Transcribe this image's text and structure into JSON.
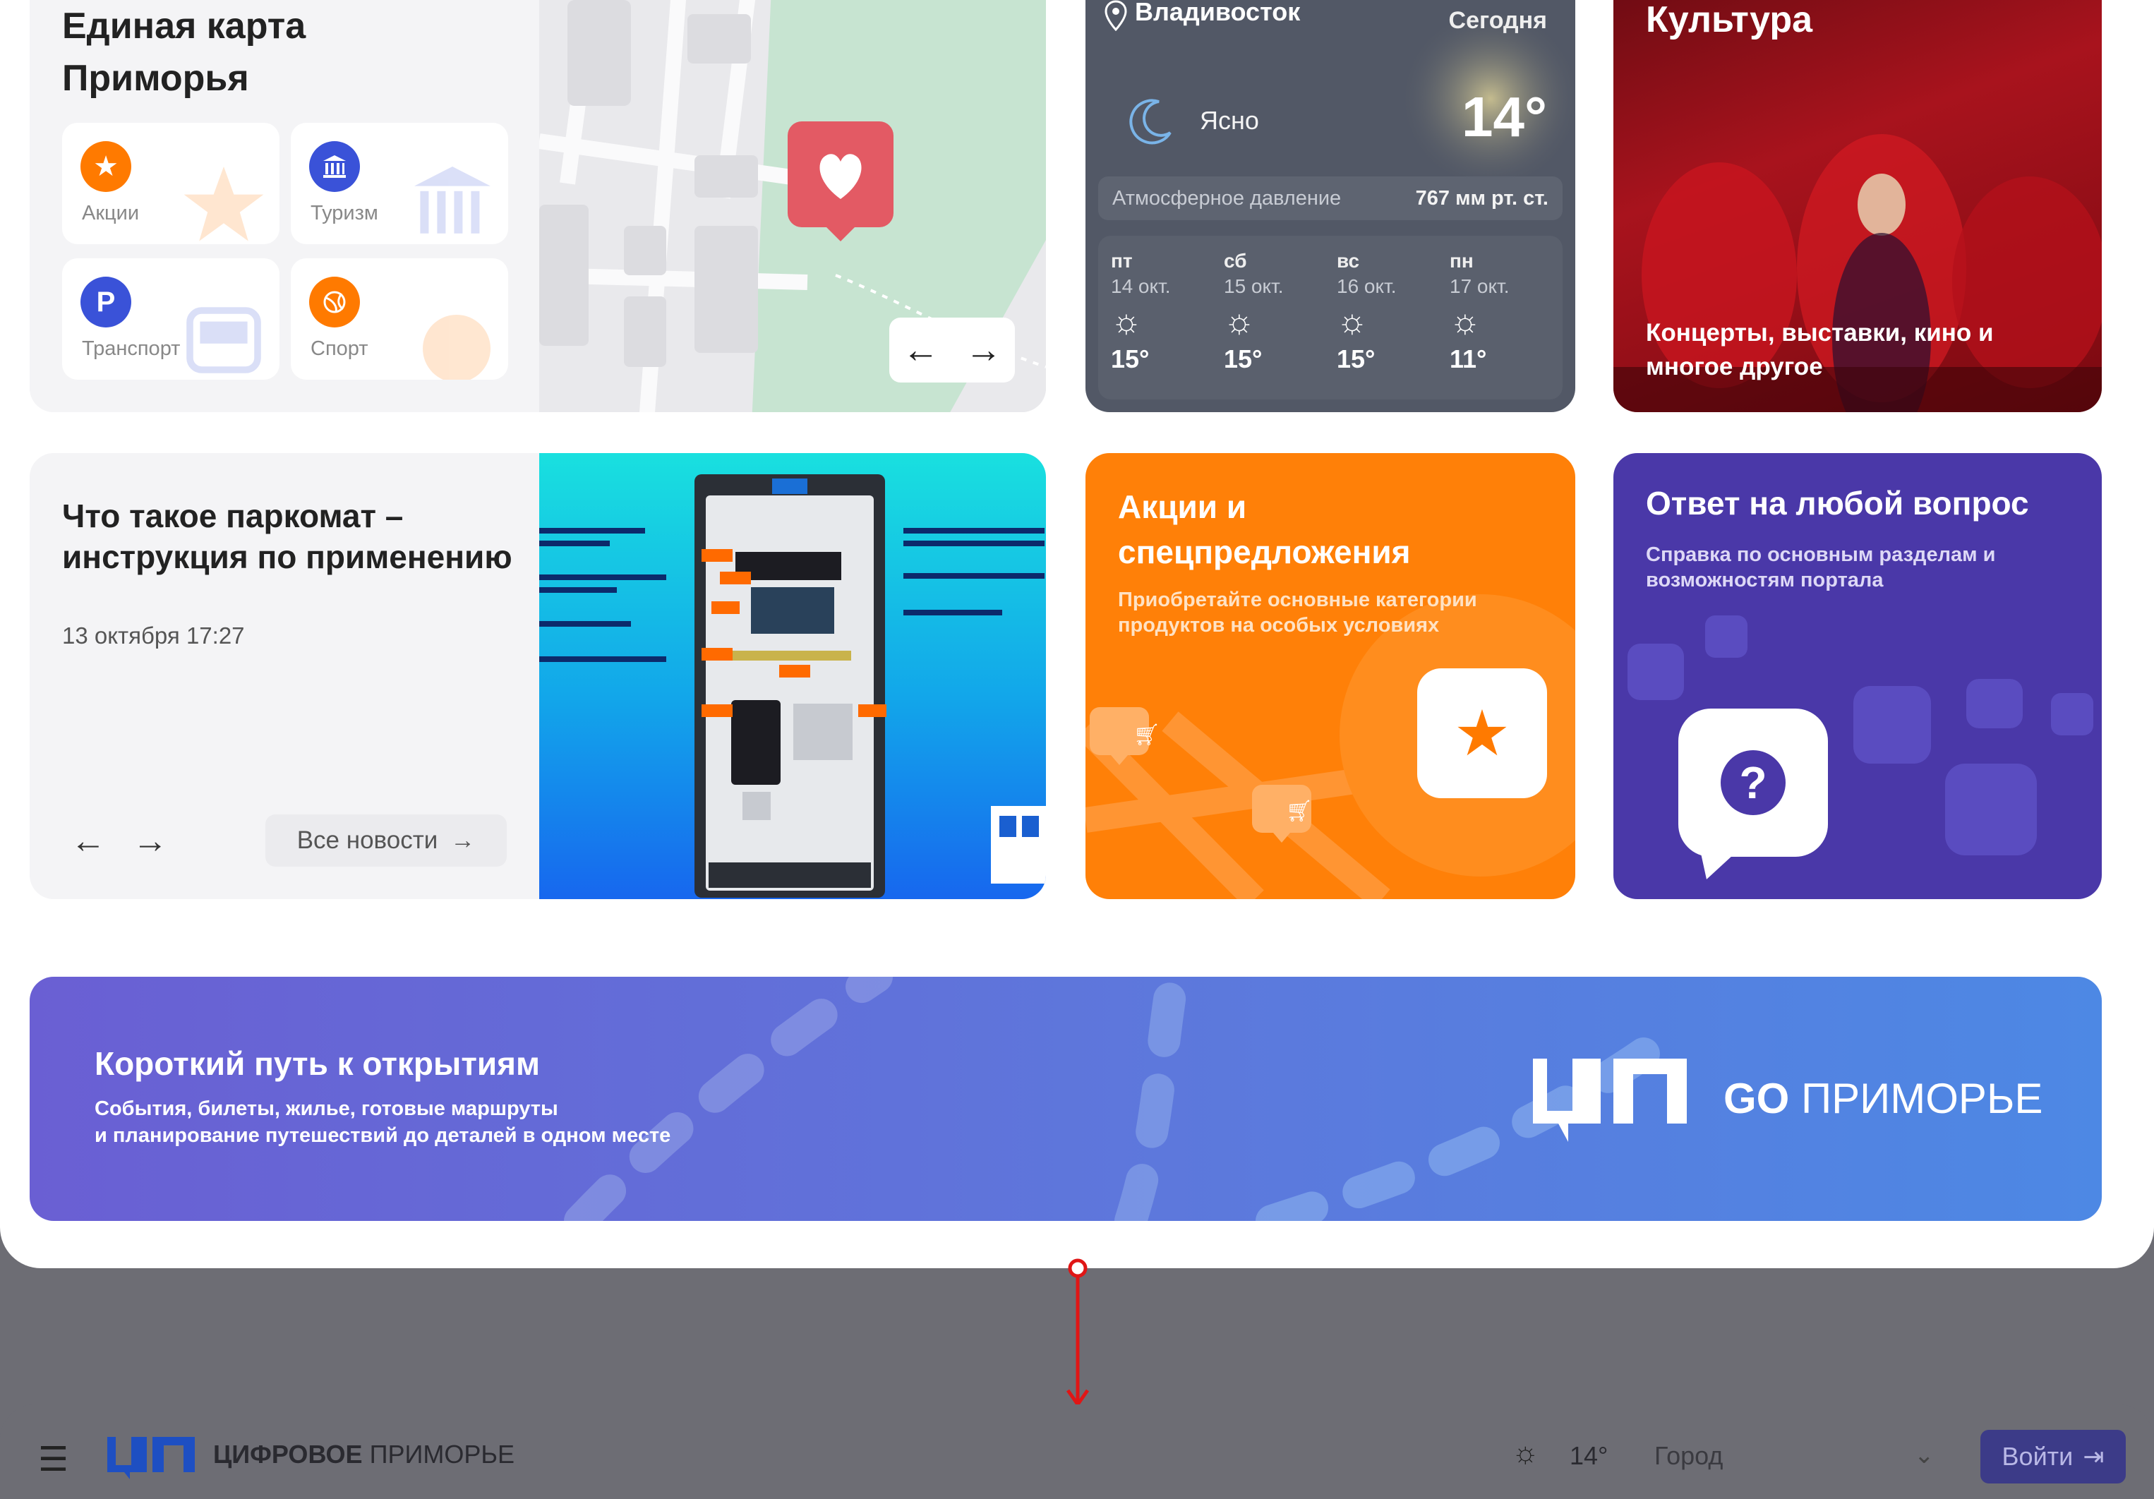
{
  "map_card": {
    "title_line1": "Единая карта",
    "title_line2": "Приморья",
    "tiles": [
      {
        "label": "Акции",
        "icon": "star-icon"
      },
      {
        "label": "Туризм",
        "icon": "museum-icon"
      },
      {
        "label": "Транспорт",
        "icon": "parking-icon"
      },
      {
        "label": "Спорт",
        "icon": "ball-icon"
      }
    ],
    "parking_symbol": "P",
    "arrow_left": "←",
    "arrow_right": "→",
    "colors": {
      "orange": "#ff7a00",
      "blue": "#3a52d8",
      "pin": "#e35a64"
    }
  },
  "weather": {
    "city": "Владивосток",
    "today": "Сегодня",
    "condition": "Ясно",
    "temperature": "14°",
    "pressure_label": "Атмосферное давление",
    "pressure_value": "767 мм рт. ст.",
    "forecast": [
      {
        "day": "пт",
        "date": "14 окт.",
        "temp": "15°"
      },
      {
        "day": "сб",
        "date": "15 окт.",
        "temp": "15°"
      },
      {
        "day": "вс",
        "date": "16 окт.",
        "temp": "15°"
      },
      {
        "day": "пн",
        "date": "17 окт.",
        "temp": "11°"
      }
    ]
  },
  "culture": {
    "title": "Культура",
    "subtitle": "Концерты, выставки, кино и многое другое"
  },
  "news": {
    "title": "Что такое паркомат – инструкция по применению",
    "date": "13 октября 17:27",
    "prev": "←",
    "next": "→",
    "all_news": "Все новости",
    "all_arrow": "→"
  },
  "promo": {
    "title": "Акции и спецпредложения",
    "subtitle": "Приобретайте основные категории продуктов на особых условиях",
    "star": "★"
  },
  "faq": {
    "title": "Ответ на любой вопрос",
    "subtitle": "Справка по основным разделам и возможностям портала",
    "question_mark": "?"
  },
  "banner": {
    "title": "Короткий путь к открытиям",
    "subtitle_line1": "События, билеты, жилье, готовые маршруты",
    "subtitle_line2": "и планирование путешествий до деталей в одном месте",
    "go_bold": "GO",
    "go_rest": "ПРИМОРЬЕ"
  },
  "header": {
    "menu_icon": "☰",
    "brand_bold": "ЦИФРОВОЕ",
    "brand_rest": "ПРИМОРЬЕ",
    "weather_icon": "☼",
    "temperature": "14°",
    "city_placeholder": "Город",
    "chevron": "⌄",
    "login_label": "Войти",
    "login_icon": "⇥"
  }
}
